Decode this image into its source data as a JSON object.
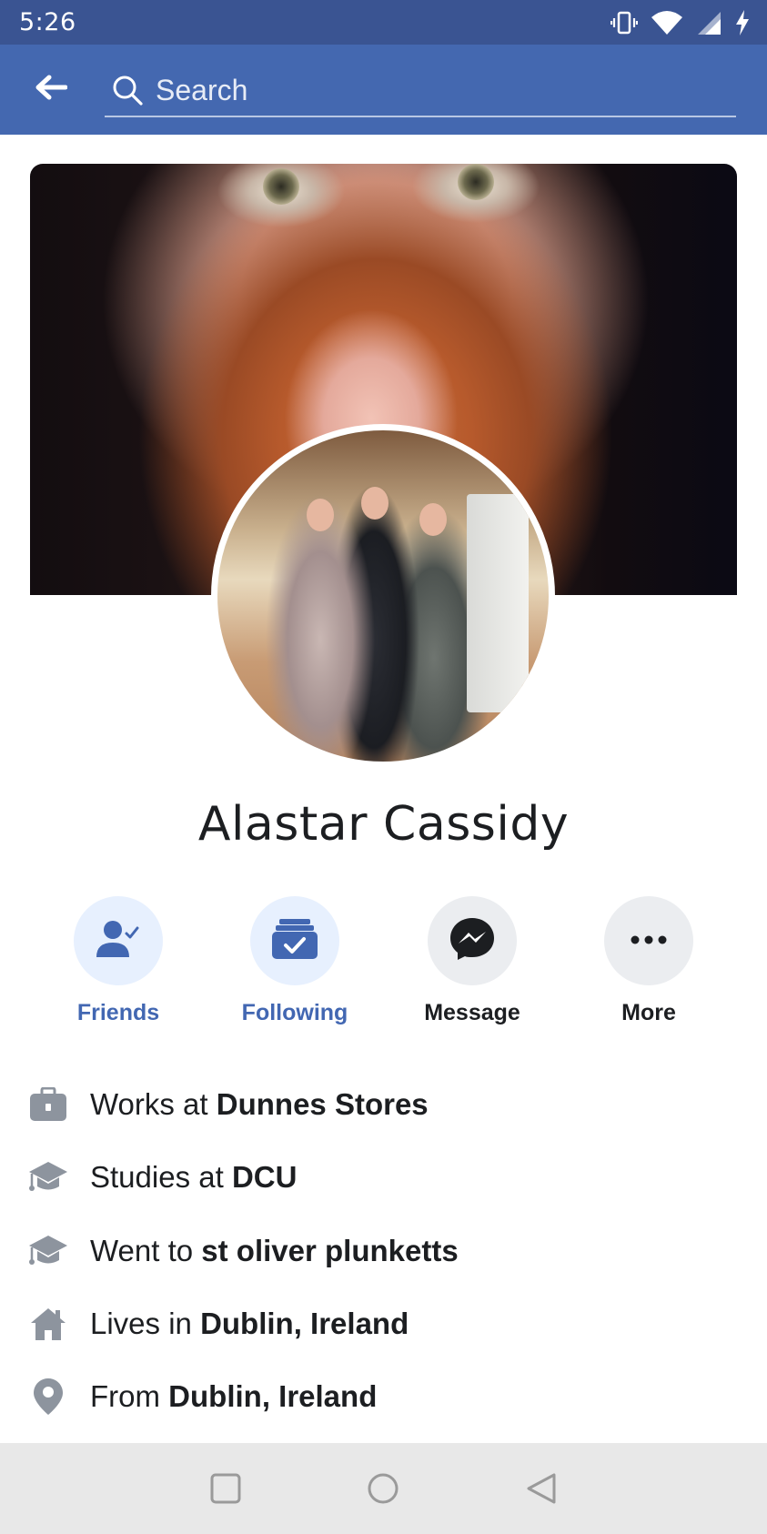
{
  "status_bar": {
    "time": "5:26",
    "icons": [
      "vibrate-icon",
      "wifi-icon",
      "signal-icon",
      "battery-charging-icon"
    ]
  },
  "header": {
    "back_icon": "arrow-left-icon",
    "search_placeholder": "Search"
  },
  "profile": {
    "name": "Alastar Cassidy"
  },
  "actions": [
    {
      "label": "Friends",
      "icon": "friends-icon",
      "state": "active"
    },
    {
      "label": "Following",
      "icon": "following-icon",
      "state": "active"
    },
    {
      "label": "Message",
      "icon": "messenger-icon",
      "state": "neutral"
    },
    {
      "label": "More",
      "icon": "more-icon",
      "state": "neutral"
    }
  ],
  "details": [
    {
      "icon": "briefcase-icon",
      "prefix": "Works at ",
      "value": "Dunnes Stores"
    },
    {
      "icon": "graduation-cap-icon",
      "prefix": "Studies at ",
      "value": "DCU"
    },
    {
      "icon": "graduation-cap-icon",
      "prefix": "Went to ",
      "value": "st oliver plunketts"
    },
    {
      "icon": "home-icon",
      "prefix": "Lives in ",
      "value": "Dublin, Ireland"
    },
    {
      "icon": "location-pin-icon",
      "prefix": "From ",
      "value": "Dublin, Ireland"
    }
  ],
  "colors": {
    "status_bar": "#3a5492",
    "header": "#4468b0",
    "accent_blue": "#4267b2",
    "active_circle": "#e7f0fe",
    "neutral_circle": "#ebedf0",
    "nav_bar": "#e8e8e8"
  }
}
